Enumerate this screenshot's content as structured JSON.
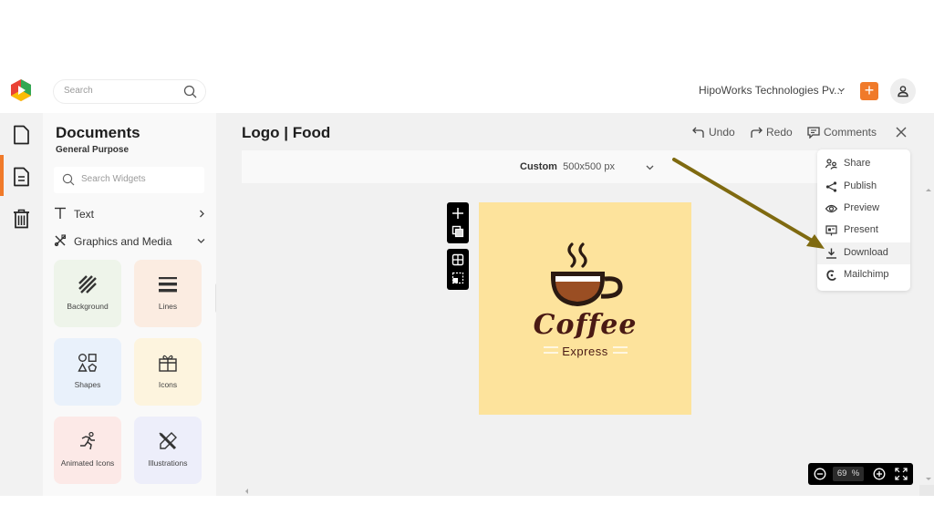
{
  "topbar": {
    "logo": "app-logo",
    "search_placeholder": "Search",
    "search_icon": "search-icon",
    "organization": "HipoWorks Technologies Pv...",
    "add_button": "+",
    "avatar_icon": "user-icon"
  },
  "rail": {
    "items": [
      {
        "name": "documents",
        "icon": "file-icon",
        "active": false
      },
      {
        "name": "templates",
        "icon": "file-text-icon",
        "active": true
      },
      {
        "name": "trash",
        "icon": "trash-icon",
        "active": false
      }
    ]
  },
  "panel": {
    "title": "Documents",
    "subtitle": "General Purpose",
    "search_placeholder": "Search Widgets",
    "categories": [
      {
        "label": "Text",
        "icon": "text-icon",
        "state": "collapsed"
      },
      {
        "label": "Graphics and Media",
        "icon": "graphics-icon",
        "state": "expanded"
      }
    ],
    "tiles": [
      {
        "label": "Background",
        "icon": "background-icon",
        "color": "#eef4ea"
      },
      {
        "label": "Lines",
        "icon": "lines-icon",
        "color": "#fbece1"
      },
      {
        "label": "Shapes",
        "icon": "shapes-icon",
        "color": "#e9f1fb"
      },
      {
        "label": "Icons",
        "icon": "gift-icon",
        "color": "#fdf4de"
      },
      {
        "label": "Animated Icons",
        "icon": "running-icon",
        "color": "#fce9e7"
      },
      {
        "label": "Illustrations",
        "icon": "pencil-ruler-icon",
        "color": "#edeefa"
      }
    ]
  },
  "main": {
    "doc_title": "Logo | Food",
    "toolbar": {
      "undo": "Undo",
      "redo": "Redo",
      "comments": "Comments"
    },
    "size": {
      "preset": "Custom",
      "dimensions": "500x500 px"
    },
    "canvas": {
      "background": "#fde39c",
      "logo_title": "Coffee",
      "logo_subtitle": "Express"
    },
    "zoom": {
      "value": "69",
      "unit": "%"
    }
  },
  "menu": {
    "items": [
      {
        "label": "Share",
        "icon": "share-users-icon"
      },
      {
        "label": "Publish",
        "icon": "share-nodes-icon"
      },
      {
        "label": "Preview",
        "icon": "eye-icon"
      },
      {
        "label": "Present",
        "icon": "present-icon"
      },
      {
        "label": "Download",
        "icon": "download-icon",
        "highlighted": true
      },
      {
        "label": "Mailchimp",
        "icon": "mailchimp-icon"
      }
    ]
  },
  "annotation": {
    "arrow_color": "#7f6a10",
    "target": "Download"
  },
  "colors": {
    "accent": "#f07a2a",
    "coffee_dark": "#4a1a14",
    "coffee_brown": "#9a4e23"
  }
}
